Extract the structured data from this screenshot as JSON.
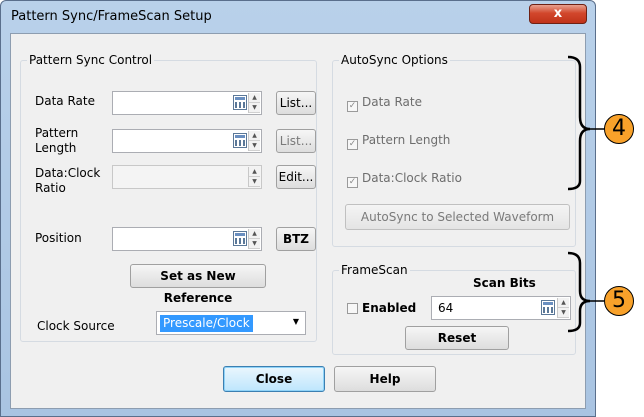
{
  "window": {
    "title": "Pattern Sync/FrameScan Setup",
    "close_glyph": "x"
  },
  "pattern_sync": {
    "title": "Pattern Sync Control",
    "data_rate_label": "Data Rate",
    "pattern_length_label": "Pattern\nLength",
    "clock_ratio_label": "Data:Clock\nRatio",
    "position_label": "Position",
    "list_btn_1": "List...",
    "list_btn_2": "List...",
    "edit_btn": "Edit...",
    "btz_btn": "BTZ",
    "set_reference_btn": "Set as New Reference",
    "clock_source_label": "Clock Source",
    "clock_source_value": "Prescale/Clock"
  },
  "autosync": {
    "title": "AutoSync Options",
    "opt_data_rate": "Data Rate",
    "opt_pattern_length": "Pattern Length",
    "opt_clock_ratio": "Data:Clock Ratio",
    "autosync_btn": "AutoSync to Selected Waveform"
  },
  "framescan": {
    "title": "FrameScan",
    "scan_bits_label": "Scan Bits",
    "enabled_label": "Enabled",
    "scan_bits_value": "64",
    "reset_btn": "Reset"
  },
  "footer": {
    "close_btn": "Close",
    "help_btn": "Help"
  },
  "callouts": {
    "c4": "4",
    "c5": "5"
  },
  "colors": {
    "callout_fill": "#f8a12a",
    "selection": "#3399ff",
    "title_bar": "#b9d1ea"
  }
}
